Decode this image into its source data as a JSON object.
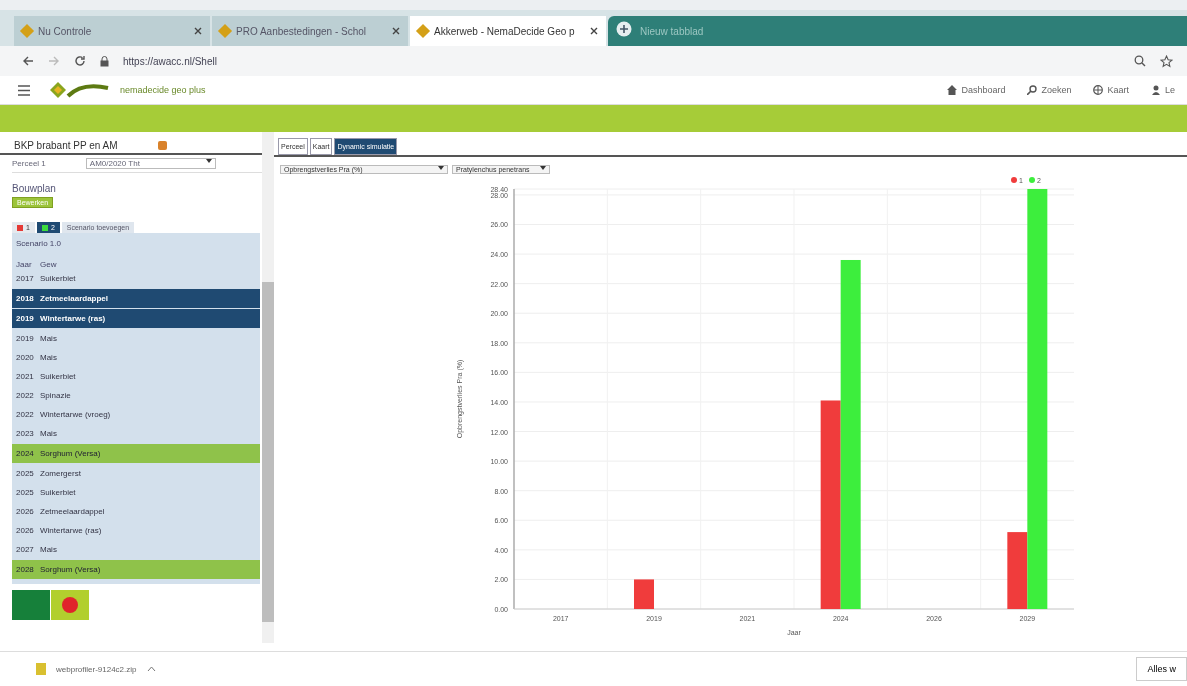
{
  "browser": {
    "tabs": [
      {
        "title": "Nu Controle",
        "selected": false
      },
      {
        "title": "PRO Aanbestedingen - Schol",
        "selected": false
      },
      {
        "title": "Akkerweb - NemaDecide Geo p",
        "selected": true
      }
    ],
    "overlay_title": "Nieuw tabblad",
    "url": "https://awacc.nl/Shell"
  },
  "app": {
    "brand": "nemadecide geo plus",
    "nav": [
      "Dashboard",
      "Zoeken",
      "Kaart",
      "Le"
    ]
  },
  "left": {
    "title": "BKP brabant PP en AM",
    "field_label": "Perceel 1",
    "field_value": "AM0/2020 Tht",
    "section": "Bouwplan",
    "edit_button": "Bewerken",
    "scenario_tabs": [
      {
        "label": "1",
        "color": "#e53935",
        "selected": false
      },
      {
        "label": "2",
        "color": "#3ddc3d",
        "selected": true
      }
    ],
    "add_scenario": "Scenario toevoegen",
    "list_title": "Scenario 1.0",
    "list_header": [
      "Jaar",
      "Gew"
    ],
    "rows": [
      {
        "year": "2017",
        "crop": "Suikerbiet",
        "kind": "plain"
      },
      {
        "year": "2018",
        "crop": "Zetmeelaardappel",
        "kind": "selected"
      },
      {
        "year": "2019",
        "crop": "Wintertarwe (ras)",
        "kind": "selected"
      },
      {
        "year": "2019",
        "crop": "Mais",
        "kind": "plain"
      },
      {
        "year": "2020",
        "crop": "Mais",
        "kind": "plain"
      },
      {
        "year": "2021",
        "crop": "Suikerbiet",
        "kind": "plain"
      },
      {
        "year": "2022",
        "crop": "Spinazie",
        "kind": "plain"
      },
      {
        "year": "2022",
        "crop": "Wintertarwe (vroeg)",
        "kind": "plain"
      },
      {
        "year": "2023",
        "crop": "Mais",
        "kind": "plain"
      },
      {
        "year": "2024",
        "crop": "Sorghum (Versa)",
        "kind": "highlight"
      },
      {
        "year": "2025",
        "crop": "Zomergerst",
        "kind": "plain"
      },
      {
        "year": "2025",
        "crop": "Suikerbiet",
        "kind": "plain"
      },
      {
        "year": "2026",
        "crop": "Zetmeelaardappel",
        "kind": "plain"
      },
      {
        "year": "2026",
        "crop": "Wintertarwe (ras)",
        "kind": "plain"
      },
      {
        "year": "2027",
        "crop": "Mais",
        "kind": "plain"
      },
      {
        "year": "2028",
        "crop": "Sorghum (Versa)",
        "kind": "highlight"
      }
    ]
  },
  "right": {
    "tabs": [
      {
        "label": "Perceel",
        "selected": false
      },
      {
        "label": "Kaart",
        "selected": false
      },
      {
        "label": "Dynamic simulatie",
        "selected": true
      }
    ],
    "selects": [
      "Opbrengstverlies Pra (%)",
      "Pratylenchus penetrans"
    ],
    "chart_data": {
      "type": "bar",
      "xlabel": "Jaar",
      "ylabel": "Opbrengstverlies Pra (%)",
      "categories": [
        "2017",
        "2019",
        "2021",
        "2024",
        "2026",
        "2029"
      ],
      "series": [
        {
          "name": "1",
          "color": "#f03c3c",
          "values": [
            0,
            2.0,
            0,
            14.1,
            0,
            5.2
          ]
        },
        {
          "name": "2",
          "color": "#3dee3d",
          "values": [
            0,
            0,
            0,
            23.6,
            0,
            28.4
          ]
        }
      ],
      "ylim": [
        0,
        28.4
      ],
      "grid": true,
      "legend": true,
      "yticks": [
        {
          "value": 0,
          "label": "0.00"
        },
        {
          "value": 2,
          "label": "2.00"
        },
        {
          "value": 4,
          "label": "4.00"
        },
        {
          "value": 6,
          "label": "6.00"
        },
        {
          "value": 8,
          "label": "8.00"
        },
        {
          "value": 10,
          "label": "10.00"
        },
        {
          "value": 12,
          "label": "12.00"
        },
        {
          "value": 14,
          "label": "14.00"
        },
        {
          "value": 16,
          "label": "16.00"
        },
        {
          "value": 18,
          "label": "18.00"
        },
        {
          "value": 20,
          "label": "20.00"
        },
        {
          "value": 22,
          "label": "22.00"
        },
        {
          "value": 24,
          "label": "24.00"
        },
        {
          "value": 26,
          "label": "26.00"
        },
        {
          "value": 28,
          "label": "28.00"
        },
        {
          "value": 28.4,
          "label": "28.40"
        }
      ]
    }
  },
  "downloads": {
    "file": "webprofiler-9124c2.zip",
    "show_all": "Alles w"
  }
}
